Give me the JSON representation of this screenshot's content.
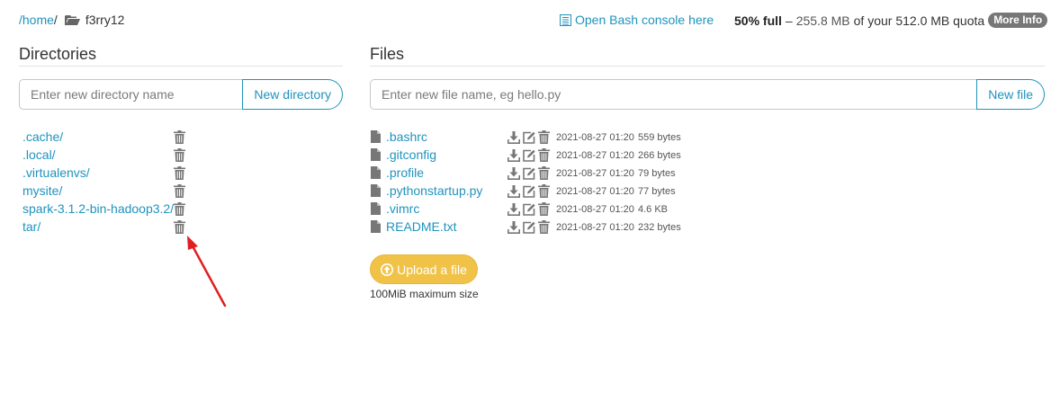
{
  "breadcrumb": {
    "home": "/home",
    "slash": "/",
    "user": "f3rry12"
  },
  "header": {
    "bash_console": "Open Bash console here",
    "quota_pct": "50% full",
    "quota_dash": "–",
    "quota_used": "255.8 MB",
    "quota_rest": "of your 512.0 MB quota",
    "more_info": "More Info"
  },
  "directories": {
    "title": "Directories",
    "placeholder": "Enter new directory name",
    "new_button": "New directory",
    "items": [
      {
        "name": ".cache/"
      },
      {
        "name": ".local/"
      },
      {
        "name": ".virtualenvs/"
      },
      {
        "name": "mysite/"
      },
      {
        "name": "spark-3.1.2-bin-hadoop3.2/"
      },
      {
        "name": "tar/"
      }
    ]
  },
  "files": {
    "title": "Files",
    "placeholder": "Enter new file name, eg hello.py",
    "new_button": "New file",
    "items": [
      {
        "name": ".bashrc",
        "date": "2021-08-27 01:20",
        "size": "559 bytes"
      },
      {
        "name": ".gitconfig",
        "date": "2021-08-27 01:20",
        "size": "266 bytes"
      },
      {
        "name": ".profile",
        "date": "2021-08-27 01:20",
        "size": "79 bytes"
      },
      {
        "name": ".pythonstartup.py",
        "date": "2021-08-27 01:20",
        "size": "77 bytes"
      },
      {
        "name": ".vimrc",
        "date": "2021-08-27 01:20",
        "size": "4.6 KB"
      },
      {
        "name": "README.txt",
        "date": "2021-08-27 01:20",
        "size": "232 bytes"
      }
    ]
  },
  "upload": {
    "button": "Upload a file",
    "note": "100MiB maximum size"
  },
  "colors": {
    "link": "#1f93bd",
    "upload": "#f0c348",
    "annotation_arrow": "#e02020",
    "badge": "#777777"
  }
}
